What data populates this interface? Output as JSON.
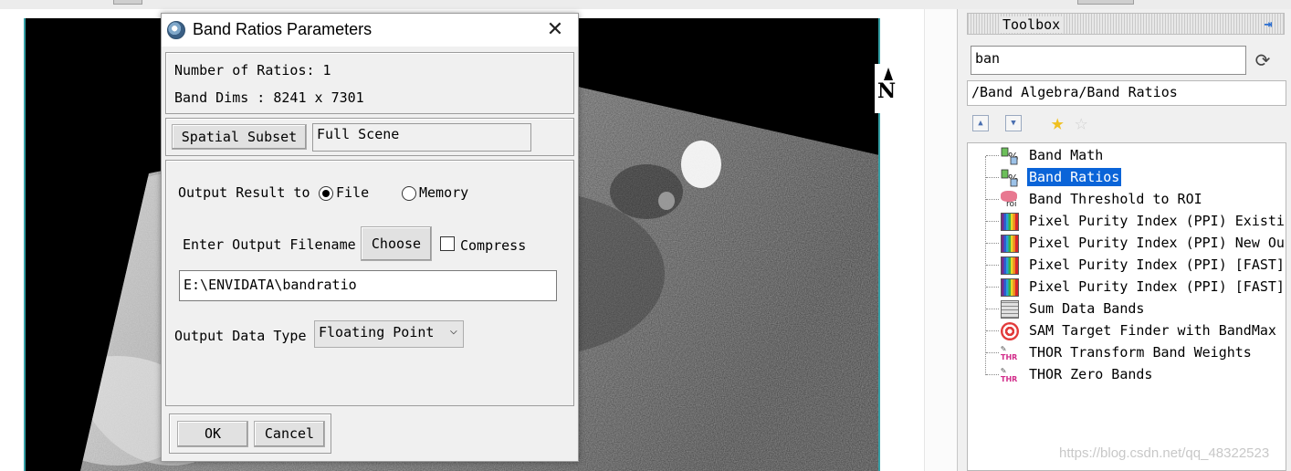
{
  "viewer": {
    "north_label": "N",
    "image_alt": "grayscale satellite image"
  },
  "toolbox": {
    "title": "Toolbox",
    "search_value": "ban",
    "path": "/Band Algebra/Band Ratios",
    "tree": [
      {
        "label": "Band Math",
        "icon": "band-math-icon",
        "selected": false
      },
      {
        "label": "Band Ratios",
        "icon": "band-math-icon",
        "selected": true
      },
      {
        "label": "Band Threshold to ROI",
        "icon": "roi-icon",
        "selected": false
      },
      {
        "label": "Pixel Purity Index (PPI) Existing",
        "icon": "spectral-bars-icon",
        "selected": false
      },
      {
        "label": "Pixel Purity Index (PPI) New Output",
        "icon": "spectral-bars-icon",
        "selected": false
      },
      {
        "label": "Pixel Purity Index (PPI) [FAST]",
        "icon": "spectral-bars-icon",
        "selected": false
      },
      {
        "label": "Pixel Purity Index (PPI) [FAST]",
        "icon": "spectral-bars-icon",
        "selected": false
      },
      {
        "label": "Sum Data Bands",
        "icon": "sum-bands-icon",
        "selected": false
      },
      {
        "label": "SAM Target Finder with BandMax",
        "icon": "target-icon",
        "selected": false
      },
      {
        "label": "THOR Transform Band Weights",
        "icon": "thor-icon",
        "selected": false
      },
      {
        "label": "THOR Zero Bands",
        "icon": "thor-icon",
        "selected": false
      }
    ],
    "watermark": "https://blog.csdn.net/qq_48322523"
  },
  "dialog": {
    "title": "Band Ratios Parameters",
    "num_ratios_label": "Number of Ratios: 1",
    "band_dims_label": "Band Dims : 8241 x 7301",
    "spatial_subset_button": "Spatial Subset",
    "subset_value": "Full Scene",
    "output_result_label": "Output Result to",
    "output_option_file": "File",
    "output_option_memory": "Memory",
    "output_selected": "File",
    "output_filename_label": "Enter Output Filename",
    "choose_button": "Choose",
    "compress_label": "Compress",
    "compress_checked": false,
    "filename_value": "E:\\ENVIDATA\\bandratio",
    "data_type_label": "Output Data Type",
    "data_type_value": "Floating Point",
    "ok_button": "OK",
    "cancel_button": "Cancel"
  },
  "colors": {
    "selection": "#0a64d8",
    "canvas_border": "#35a0a6",
    "dialog_bg": "#f0f0f0"
  }
}
